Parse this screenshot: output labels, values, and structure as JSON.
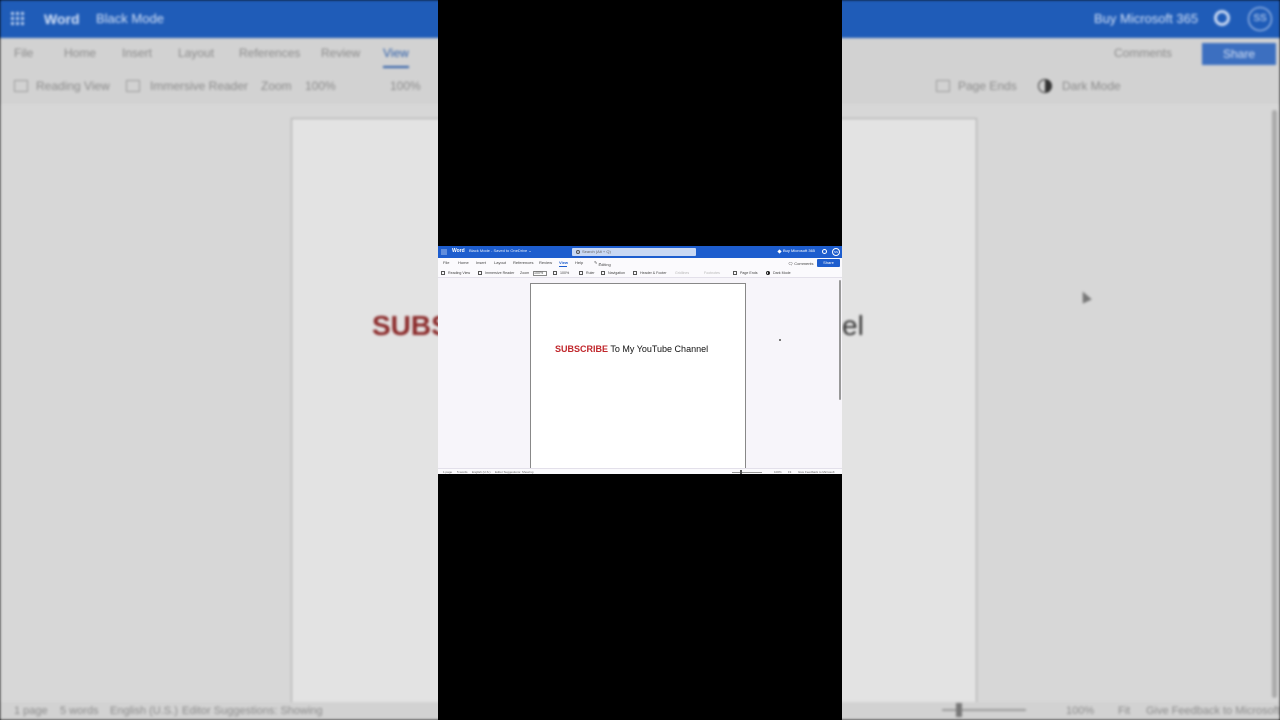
{
  "app": {
    "name": "Word",
    "document": "Black Mode",
    "save_status": "Saved to OneDrive",
    "search_placeholder": "Search (Alt + Q)",
    "buy": "Buy Microsoft 365",
    "avatar_initials": "SS"
  },
  "menu": {
    "items": [
      "File",
      "Home",
      "Insert",
      "Layout",
      "References",
      "Review",
      "View",
      "Help"
    ],
    "active": "View",
    "editing": "Editing",
    "comments": "Comments",
    "share": "Share"
  },
  "ribbon": {
    "reading_view": "Reading View",
    "immersive_reader": "Immersive Reader",
    "zoom_label": "Zoom",
    "zoom_value": "100%",
    "zoom_100": "100%",
    "ruler": "Ruler",
    "navigation": "Navigation",
    "header_footer": "Header & Footer",
    "gridlines": "Gridlines",
    "footnotes": "Footnotes",
    "page_ends": "Page Ends",
    "dark_mode": "Dark Mode"
  },
  "document": {
    "highlight": "SUBSCRIBE",
    "rest": " To My YouTube Channel",
    "highlight_color": "#c0262b"
  },
  "background_zoom": {
    "left_fragment": "SUBS",
    "right_fragment": "el"
  },
  "status": {
    "pages": "1 page",
    "words": "5 words",
    "language": "English (U.S.)",
    "editor": "Editor Suggestions: Showing",
    "zoom": "100%",
    "fit": "Fit",
    "feedback": "Give Feedback to Microsoft"
  },
  "colors": {
    "titlebar": "#1d5dce",
    "accent": "#1d5dce"
  }
}
